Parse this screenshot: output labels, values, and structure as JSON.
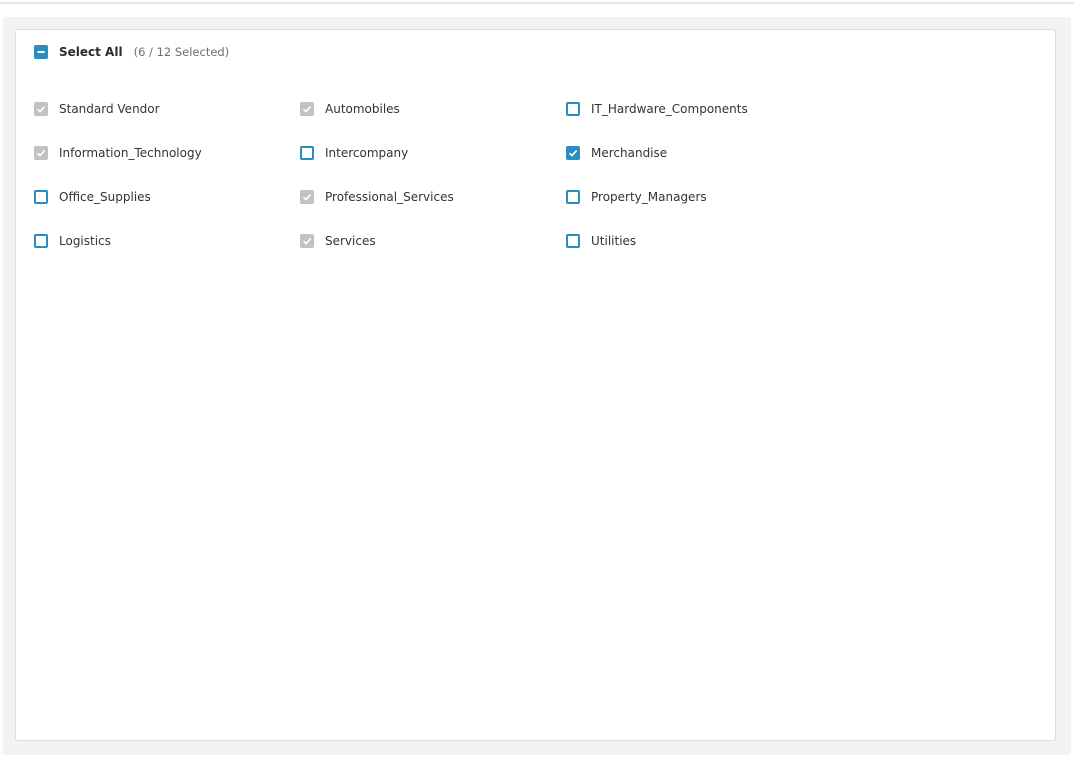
{
  "select_all": {
    "label": "Select All",
    "count_text": "(6 / 12 Selected)",
    "state": "indeterminate"
  },
  "colors": {
    "accent": "#2a8dc0",
    "disabled": "#c2c2c2"
  },
  "options": [
    {
      "label": "Standard Vendor",
      "state": "disabled-checked"
    },
    {
      "label": "Automobiles",
      "state": "disabled-checked"
    },
    {
      "label": "IT_Hardware_Components",
      "state": "unchecked"
    },
    {
      "label": "Information_Technology",
      "state": "disabled-checked"
    },
    {
      "label": "Intercompany",
      "state": "unchecked"
    },
    {
      "label": "Merchandise",
      "state": "checked"
    },
    {
      "label": "Office_Supplies",
      "state": "unchecked"
    },
    {
      "label": "Professional_Services",
      "state": "disabled-checked"
    },
    {
      "label": "Property_Managers",
      "state": "unchecked"
    },
    {
      "label": "Logistics",
      "state": "unchecked"
    },
    {
      "label": "Services",
      "state": "disabled-checked"
    },
    {
      "label": "Utilities",
      "state": "unchecked"
    }
  ]
}
